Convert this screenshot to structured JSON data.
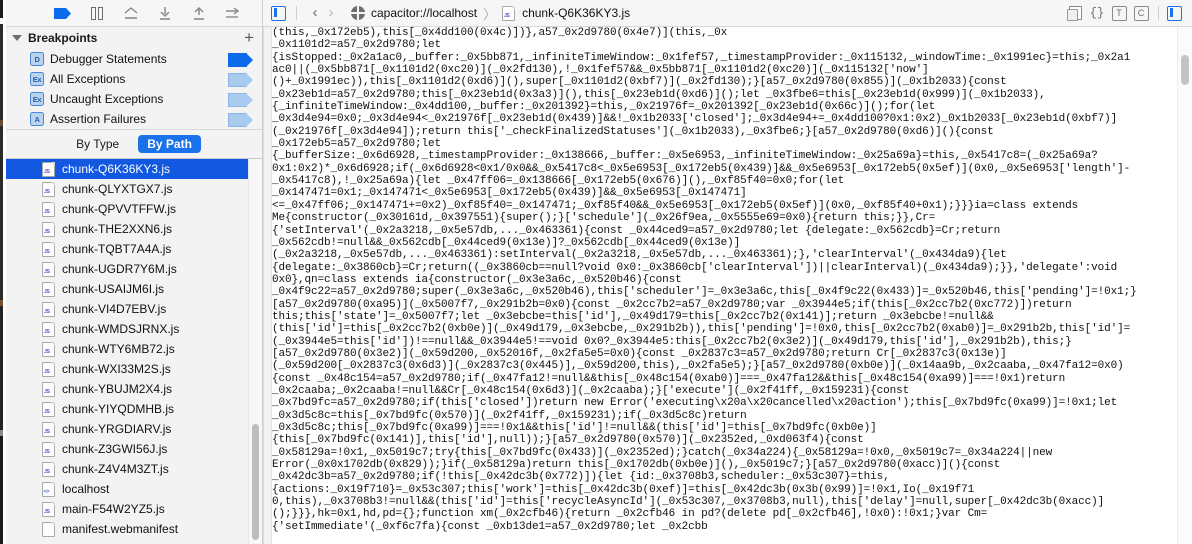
{
  "debug_toolbar": {
    "icons": [
      {
        "name": "breakpoint-flag-icon",
        "glyph": "flag",
        "active": true
      },
      {
        "name": "pause-icon",
        "glyph": "pause"
      },
      {
        "name": "step-over-icon",
        "glyph": "step-over"
      },
      {
        "name": "step-into-icon",
        "glyph": "step-into"
      },
      {
        "name": "step-out-icon",
        "glyph": "step-out"
      },
      {
        "name": "step-icon",
        "glyph": "step"
      }
    ]
  },
  "breakpoints": {
    "title": "Breakpoints",
    "add_label": "+",
    "items": [
      {
        "icon": "D",
        "label": "Debugger Statements",
        "enabled": true
      },
      {
        "icon": "Ex",
        "label": "All Exceptions",
        "enabled": false
      },
      {
        "icon": "Ex",
        "label": "Uncaught Exceptions",
        "enabled": false
      },
      {
        "icon": "A",
        "label": "Assertion Failures",
        "enabled": false
      }
    ]
  },
  "segmented": {
    "by_type": "By Type",
    "by_path": "By Path",
    "selected": "By Path"
  },
  "files": [
    {
      "name": "chunk-Q6K36KY3.js",
      "type": "js",
      "selected": true
    },
    {
      "name": "chunk-QLYXTGX7.js",
      "type": "js",
      "selected": false
    },
    {
      "name": "chunk-QPVVTFFW.js",
      "type": "js",
      "selected": false
    },
    {
      "name": "chunk-THE2XXN6.js",
      "type": "js",
      "selected": false
    },
    {
      "name": "chunk-TQBT7A4A.js",
      "type": "js",
      "selected": false
    },
    {
      "name": "chunk-UGDR7Y6M.js",
      "type": "js",
      "selected": false
    },
    {
      "name": "chunk-USAIJM6I.js",
      "type": "js",
      "selected": false
    },
    {
      "name": "chunk-VI4D7EBV.js",
      "type": "js",
      "selected": false
    },
    {
      "name": "chunk-WMDSJRNX.js",
      "type": "js",
      "selected": false
    },
    {
      "name": "chunk-WTY6MB72.js",
      "type": "js",
      "selected": false
    },
    {
      "name": "chunk-WXI33M2S.js",
      "type": "js",
      "selected": false
    },
    {
      "name": "chunk-YBUJM2X4.js",
      "type": "js",
      "selected": false
    },
    {
      "name": "chunk-YIYQDMHB.js",
      "type": "js",
      "selected": false
    },
    {
      "name": "chunk-YRGDIARV.js",
      "type": "js",
      "selected": false
    },
    {
      "name": "chunk-Z3GWI56J.js",
      "type": "js",
      "selected": false
    },
    {
      "name": "chunk-Z4V4M3ZT.js",
      "type": "js",
      "selected": false
    },
    {
      "name": "localhost",
      "type": "html",
      "selected": false
    },
    {
      "name": "main-F54W2YZ5.js",
      "type": "js",
      "selected": false
    },
    {
      "name": "manifest.webmanifest",
      "type": "plain",
      "selected": false
    }
  ],
  "navbar": {
    "back_glyph": "‹",
    "forward_glyph": "›",
    "origin": "capacitor://localhost",
    "separator": "〉",
    "file": "chunk-Q6K36KY3.js",
    "right_icons": [
      {
        "name": "copy-icon",
        "label": ""
      },
      {
        "name": "pretty-print-icon",
        "label": "{}"
      },
      {
        "name": "text-mode-icon",
        "label": "T"
      },
      {
        "name": "continuous-icon",
        "label": "C"
      }
    ]
  },
  "editor": {
    "source": "(this,_0x172eb5),this[_0x4dd100(0x4c)])},a57_0x2d9780(0x4e7)](this,_0x\n_0x1101d2=a57_0x2d9780;let\n{isStopped:_0x2a1ac0,_buffer:_0x5bb871,_infiniteTimeWindow:_0x1fef57,_timestampProvider:_0x115132,_windowTime:_0x1991ec}=this;_0x2a1\nac0||(_0x5bb871[_0x1101d2(0xc20)](_0x2fd130),!_0x1fef57&&_0x5bb871[_0x1101d2(0xc20)](_0x115132['now']\n()+_0x1991ec)),this[_0x1101d2(0xd6)](),super[_0x1101d2(0xbf7)](_0x2fd130);}[a57_0x2d9780(0x855)](_0x1b2033){const\n_0x23eb1d=a57_0x2d9780;this[_0x23eb1d(0x3a3)](),this[_0x23eb1d(0xd6)]();let _0x3fbe6=this[_0x23eb1d(0x999)](_0x1b2033),\n{_infiniteTimeWindow:_0x4dd100,_buffer:_0x201392}=this,_0x21976f=_0x201392[_0x23eb1d(0x66c)]();for(let\n_0x3d4e94=0x0;_0x3d4e94<_0x21976f[_0x23eb1d(0x439)]&&!_0x1b2033['closed'];_0x3d4e94+=_0x4dd100?0x1:0x2)_0x1b2033[_0x23eb1d(0xbf7)]\n(_0x21976f[_0x3d4e94]);return this['_checkFinalizedStatuses'](_0x1b2033),_0x3fbe6;}[a57_0x2d9780(0xd6)](){const\n_0x172eb5=a57_0x2d9780;let\n{_bufferSize:_0x6d6928,_timestampProvider:_0x138666,_buffer:_0x5e6953,_infiniteTimeWindow:_0x25a69a}=this,_0x5417c8=(_0x25a69a?\n0x1:0x2)*_0x6d6928;if(_0x6d6928<0x1/0x0&&_0x5417c8<_0x5e6953[_0x172eb5(0x439)]&&_0x5e6953[_0x172eb5(0x5ef)](0x0,_0x5e6953['length']-\n_0x5417c8),!_0x25a69a){let _0x47ff06=_0x138666[_0x172eb5(0x676)](),_0xf85f40=0x0;for(let\n_0x147471=0x1;_0x147471<_0x5e6953[_0x172eb5(0x439)]&&_0x5e6953[_0x147471]\n<=_0x47ff06;_0x147471+=0x2)_0xf85f40=_0x147471;_0xf85f40&&_0x5e6953[_0x172eb5(0x5ef)](0x0,_0xf85f40+0x1);}}}ia=class extends\nMe{constructor(_0x30161d,_0x397551){super();}['schedule'](_0x26f9ea,_0x5555e69=0x0){return this;}},Cr=\n{'setInterval'(_0x2a3218,_0x5e57db,..._0x463361){const _0x44ced9=a57_0x2d9780;let {delegate:_0x562cdb}=Cr;return\n_0x562cdb!=null&&_0x562cdb[_0x44ced9(0x13e)]?_0x562cdb[_0x44ced9(0x13e)]\n(_0x2a3218,_0x5e57db,..._0x463361):setInterval(_0x2a3218,_0x5e57db,..._0x463361);},'clearInterval'(_0x434da9){let\n{delegate:_0x3860cb}=Cr;return((_0x3860cb==null?void 0x0:_0x3860cb['clearInterval'])||clearInterval)(_0x434da9);}},'delegate':void\n0x0},qn=class extends ia{constructor(_0x3e3a6c,_0x520b46){const\n_0x4f9c22=a57_0x2d9780;super(_0x3e3a6c,_0x520b46),this['scheduler']=_0x3e3a6c,this[_0x4f9c22(0x433)]=_0x520b46,this['pending']=!0x1;}\n[a57_0x2d9780(0xa95)](_0x5007f7,_0x291b2b=0x0){const _0x2cc7b2=a57_0x2d9780;var _0x3944e5;if(this[_0x2cc7b2(0xc772)])return\nthis;this['state']=_0x5007f7;let _0x3ebcbe=this['id'],_0x49d179=this[_0x2cc7b2(0x141)];return _0x3ebcbe!=null&&\n(this['id']=this[_0x2cc7b2(0xb0e)](_0x49d179,_0x3ebcbe,_0x291b2b)),this['pending']=!0x0,this[_0x2cc7b2(0xab0)]=_0x291b2b,this['id']=\n(_0x3944e5=this['id'])!==null&&_0x3944e5!==void 0x0?_0x3944e5:this[_0x2cc7b2(0x3e2)](_0x49d179,this['id'],_0x291b2b),this;}\n[a57_0x2d9780(0x3e2)](_0x59d200,_0x52016f,_0x2fa5e5=0x0){const _0x2837c3=a57_0x2d9780;return Cr[_0x2837c3(0x13e)]\n(_0x59d200[_0x2837c3(0x6d3)](_0x2837c3(0x445)],_0x59d200,this),_0x2fa5e5);}[a57_0x2d9780(0xb0e)](_0x14aa9b,_0x2caaba,_0x47fa12=0x0)\n{const _0x48c154=a57_0x2d9780;if(_0x47fa12!=null&&this[_0x48c154(0xab0)]===_0x47fa12&&this[_0x48c154(0xa99)]===!0x1)return\n_0x2caaba;_0x2caaba!=null&&Cr[_0x48c154(0x6d3)](_0x2caaba);}['execute'](_0x2f41ff,_0x159231){const\n_0x7bd9fc=a57_0x2d9780;if(this['closed'])return new Error('executing\\x20a\\x20cancelled\\x20action');this[_0x7bd9fc(0xa99)]=!0x1;let\n_0x3d5c8c=this[_0x7bd9fc(0x570)](_0x2f41ff,_0x159231);if(_0x3d5c8c)return\n_0x3d5c8c;this[_0x7bd9fc(0xa99)]===!0x1&&this['id']!=null&&(this['id']=this[_0x7bd9fc(0xb0e)]\n{this[_0x7bd9fc(0x141)],this['id'],null));}[a57_0x2d9780(0x570)](_0x2352ed,_0xd063f4){const\n_0x58129a=!0x1,_0x5019c7;try{this[_0x7bd9fc(0x433)](_0x2352ed);}catch(_0x34a224){_0x58129a=!0x0,_0x5019c7=_0x34a224||new\nError(_0x0x1702db(0x829));}if(_0x58129a)return this[_0x1702db(0xb0e)](),_0x5019c7;}[a57_0x2d9780(0xacc)](){const\n_0x42dc3b=a57_0x2d9780;if(!this[_0x42dc3b(0x772)]){let {id:_0x3708b3,scheduler:_0x53c307}=this,\n{actions:_0x19f710}=_0x53c307;this['work']=this[_0x42dc3b(0xef)]=this[_0x42dc3b(0x3b(0x99)]=!0x1,Io(_0x19f71\n0,this),_0x3708b3!=null&&(this['id']=this['recycleAsyncId'](_0x53c307,_0x3708b3,null),this['delay']=null,super[_0x42dc3b(0xacc)]\n();}}},hk=0x1,hd,pd={};function xm(_0x2cfb46){return _0x2cfb46 in pd?(delete pd[_0x2cfb46],!0x0):!0x1;}var Cm=\n{'setImmediate'(_0xf6c7fa){const _0xb13de1=a57_0x2d9780;let _0x2cbb"
  },
  "scrollbars": {
    "sidebar_visible": true,
    "code_visible": true
  }
}
